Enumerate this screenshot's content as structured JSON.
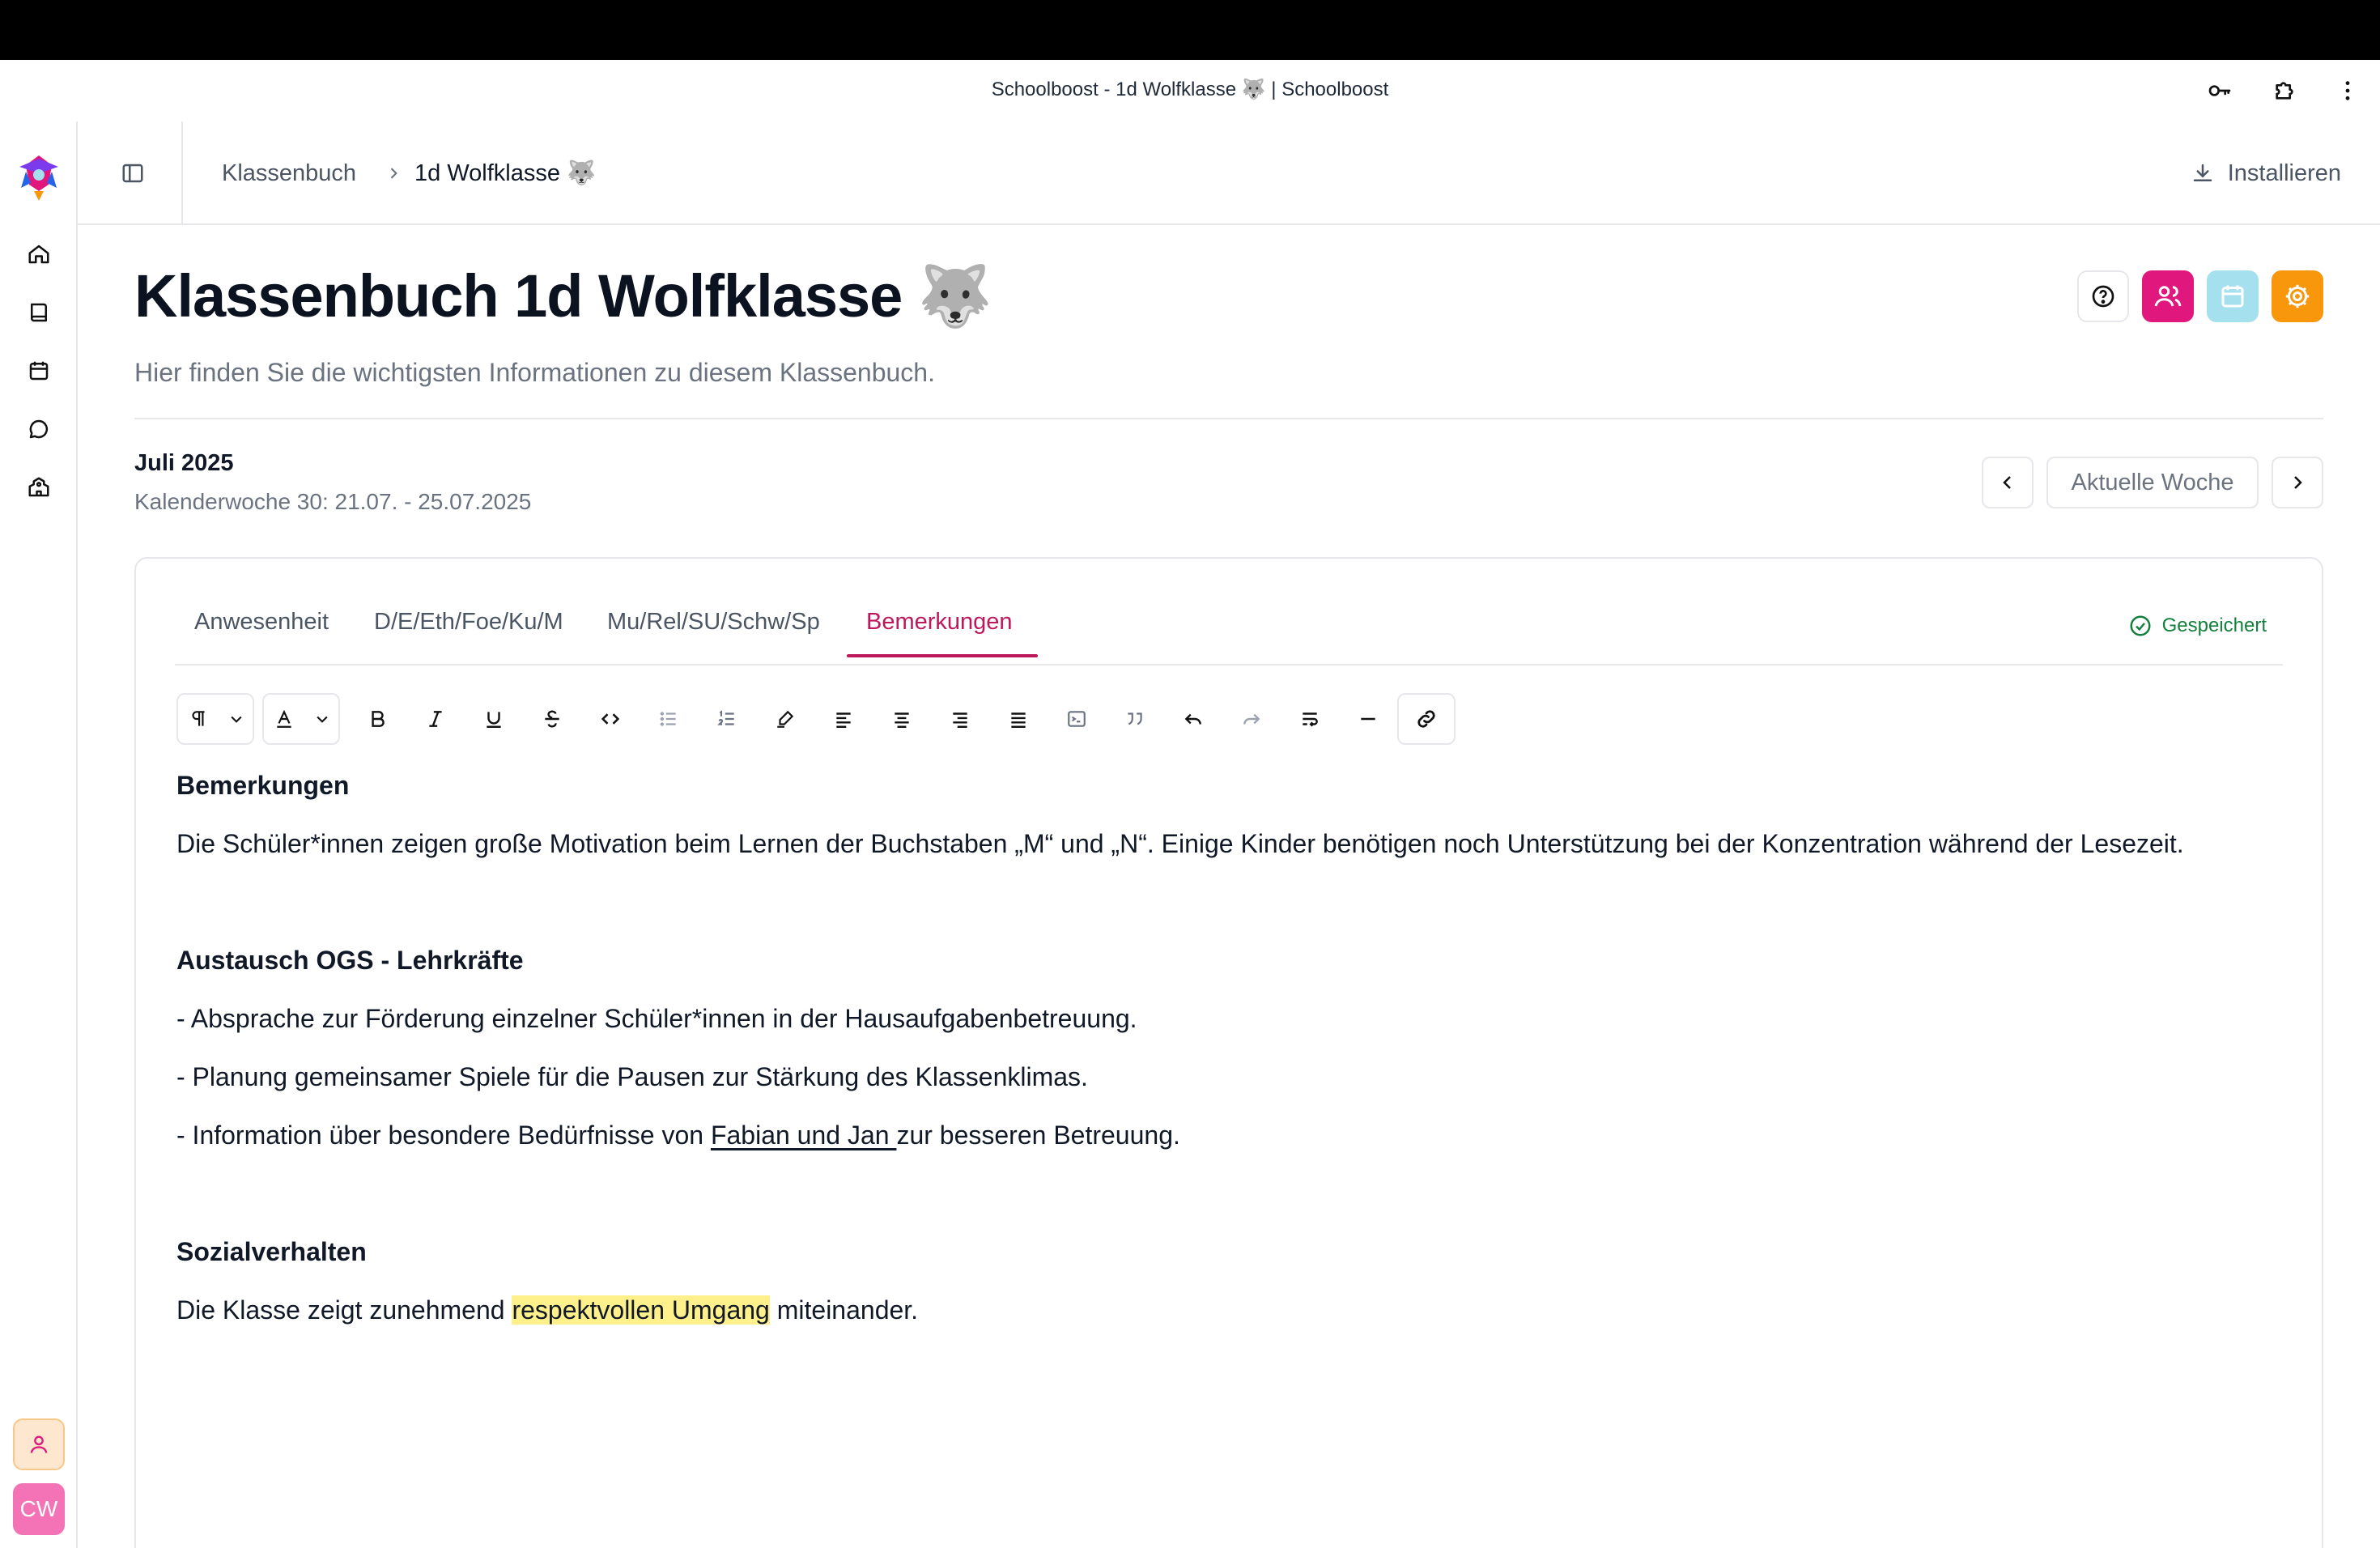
{
  "window": {
    "title": "Schoolboost - 1d Wolfklasse 🐺 | Schoolboost"
  },
  "header": {
    "breadcrumb": [
      {
        "label": "Klassenbuch"
      },
      {
        "label": "1d Wolfklasse 🐺"
      }
    ],
    "install_label": "Installieren"
  },
  "sidebar": {
    "items": [
      {
        "icon": "home-icon"
      },
      {
        "icon": "book-icon"
      },
      {
        "icon": "calendar-icon"
      },
      {
        "icon": "message-icon"
      },
      {
        "icon": "school-icon"
      }
    ],
    "avatar_initials": "CW"
  },
  "page": {
    "title": "Klassenbuch 1d Wolfklasse 🐺",
    "subtitle": "Hier finden Sie die wichtigsten Informationen zu diesem Klassenbuch.",
    "month": "Juli 2025",
    "week": "Kalenderwoche 30: 21.07. - 25.07.2025",
    "current_week_label": "Aktuelle Woche"
  },
  "colors": {
    "accent_pink": "#e0177c",
    "accent_cyan": "#a5e0ee",
    "accent_orange": "#f8960c",
    "active_tab": "#be185d",
    "saved_green": "#15803d",
    "highlight": "#fef08a"
  },
  "tabs": [
    {
      "label": "Anwesenheit",
      "active": false
    },
    {
      "label": "D/E/Eth/Foe/Ku/M",
      "active": false
    },
    {
      "label": "Mu/Rel/SU/Schw/Sp",
      "active": false
    },
    {
      "label": "Bemerkungen",
      "active": true
    }
  ],
  "status": {
    "saved_label": "Gespeichert"
  },
  "toolbar": {
    "tools": [
      "paragraph-icon",
      "text-color-icon",
      "bold-icon",
      "italic-icon",
      "underline-icon",
      "strikethrough-icon",
      "code-icon",
      "bullet-list-icon",
      "ordered-list-icon",
      "highlight-icon",
      "align-left-icon",
      "align-center-icon",
      "align-right-icon",
      "align-justify-icon",
      "code-block-icon",
      "quote-icon",
      "undo-icon",
      "redo-icon",
      "wrap-icon",
      "horizontal-rule-icon",
      "link-icon"
    ]
  },
  "editor": {
    "heading1": "Bemerkungen",
    "p1": "Die Schüler*innen zeigen große Motivation beim Lernen der Buchstaben „M“ und „N“. Einige Kinder benötigen noch Unterstützung bei der Konzentration während der Lesezeit.",
    "heading2": "Austausch OGS - Lehrkräfte",
    "b1": "- Absprache zur Förderung einzelner Schüler*innen in der Hausaufgabenbetreuung.",
    "b2": "- Planung gemeinsamer Spiele für die Pausen zur Stärkung des Klassenklimas.",
    "b3_pre": "- Information über besondere Bedürfnisse von ",
    "b3_link": "Fabian und Jan ",
    "b3_post": "zur besseren Betreuung.",
    "heading3": "Sozialverhalten",
    "p3_pre": "Die Klasse zeigt zunehmend ",
    "p3_hl": "respektvollen Umgang",
    "p3_post": " miteinander."
  }
}
